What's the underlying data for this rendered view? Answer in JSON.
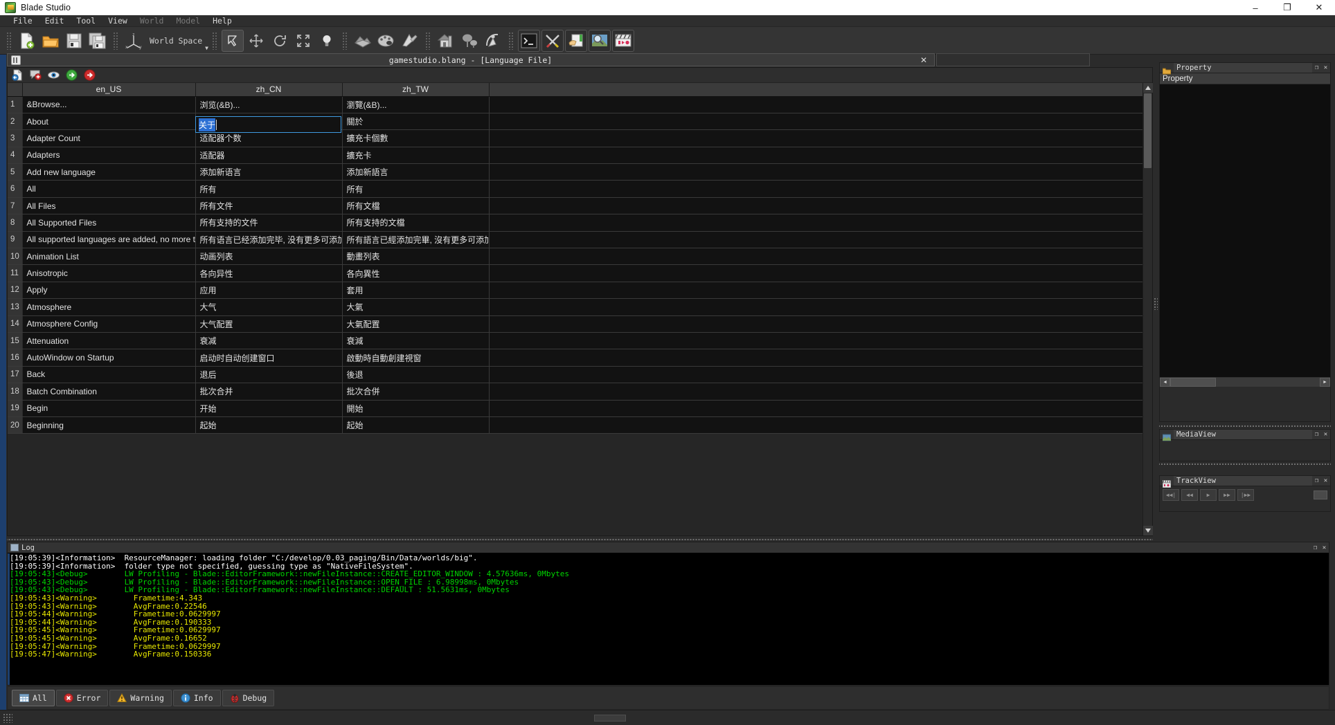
{
  "window": {
    "title": "Blade Studio",
    "app_icon": "app-icon",
    "minimize": "–",
    "maximize": "❐",
    "close": "✕"
  },
  "menu": {
    "items": [
      {
        "label": "File",
        "enabled": true
      },
      {
        "label": "Edit",
        "enabled": true
      },
      {
        "label": "Tool",
        "enabled": true
      },
      {
        "label": "View",
        "enabled": true
      },
      {
        "label": "World",
        "enabled": false
      },
      {
        "label": "Model",
        "enabled": false
      },
      {
        "label": "Help",
        "enabled": true
      }
    ]
  },
  "toolbar": {
    "space_label": "World Space",
    "groups": [
      {
        "icons": [
          "new-file-icon",
          "open-folder-icon",
          "save-icon",
          "save-all-icon"
        ]
      },
      {
        "icons": [
          "axis-gizmo-icon"
        ]
      },
      {
        "icons": [
          "select-arrow-icon",
          "move-icon",
          "rotate-icon",
          "scale-icon",
          "light-icon"
        ]
      },
      {
        "icons": [
          "terrain-icon",
          "palette-icon",
          "paint-icon"
        ]
      },
      {
        "icons": [
          "house-icon",
          "tree-icon",
          "physics-icon"
        ]
      },
      {
        "icons": [
          "console-icon",
          "tools-icon",
          "hand-paper-icon",
          "image-preview-icon",
          "clapperboard-icon"
        ]
      }
    ]
  },
  "document_tab": {
    "icon": "language-table-icon",
    "title": "gamestudio.blang - [Language File]",
    "close_label": "✕"
  },
  "editor_toolbar": {
    "icons": [
      "import-document-icon",
      "add-comment-icon",
      "eye-preview-icon",
      "next-green-icon",
      "jump-red-icon"
    ]
  },
  "table": {
    "columns": [
      "en_US",
      "zh_CN",
      "zh_TW"
    ],
    "editing": {
      "row": 2,
      "column": "zh_CN",
      "value": "关于",
      "selected": true
    },
    "rows": [
      {
        "n": "1",
        "en_US": "&Browse...",
        "zh_CN": "浏览(&B)...",
        "zh_TW": "瀏覽(&B)..."
      },
      {
        "n": "2",
        "en_US": "About",
        "zh_CN": "关于",
        "zh_TW": "關於"
      },
      {
        "n": "3",
        "en_US": "Adapter Count",
        "zh_CN": "适配器个数",
        "zh_TW": "擴充卡個數"
      },
      {
        "n": "4",
        "en_US": "Adapters",
        "zh_CN": "适配器",
        "zh_TW": "擴充卡"
      },
      {
        "n": "5",
        "en_US": "Add new language",
        "zh_CN": "添加新语言",
        "zh_TW": "添加新語言"
      },
      {
        "n": "6",
        "en_US": "All",
        "zh_CN": "所有",
        "zh_TW": "所有"
      },
      {
        "n": "7",
        "en_US": "All Files",
        "zh_CN": "所有文件",
        "zh_TW": "所有文檔"
      },
      {
        "n": "8",
        "en_US": "All Supported Files",
        "zh_CN": "所有支持的文件",
        "zh_TW": "所有支持的文檔"
      },
      {
        "n": "9",
        "en_US": "All supported languages are added, no more to add.",
        "zh_CN": "所有语言已经添加完毕, 没有更多可添加的语言.",
        "zh_TW": "所有語言已經添加完畢, 沒有更多可添加的語言."
      },
      {
        "n": "10",
        "en_US": "Animation List",
        "zh_CN": "动画列表",
        "zh_TW": "動畫列表"
      },
      {
        "n": "11",
        "en_US": "Anisotropic",
        "zh_CN": "各向异性",
        "zh_TW": "各向異性"
      },
      {
        "n": "12",
        "en_US": "Apply",
        "zh_CN": "应用",
        "zh_TW": "套用"
      },
      {
        "n": "13",
        "en_US": "Atmosphere",
        "zh_CN": "大气",
        "zh_TW": "大氣"
      },
      {
        "n": "14",
        "en_US": "Atmosphere Config",
        "zh_CN": "大气配置",
        "zh_TW": "大氣配置"
      },
      {
        "n": "15",
        "en_US": "Attenuation",
        "zh_CN": "衰减",
        "zh_TW": "衰減"
      },
      {
        "n": "16",
        "en_US": "AutoWindow on Startup",
        "zh_CN": "启动时自动创建窗口",
        "zh_TW": "啟動時自動創建視窗"
      },
      {
        "n": "17",
        "en_US": "Back",
        "zh_CN": "退后",
        "zh_TW": "後退"
      },
      {
        "n": "18",
        "en_US": "Batch Combination",
        "zh_CN": "批次合并",
        "zh_TW": "批次合併"
      },
      {
        "n": "19",
        "en_US": "Begin",
        "zh_CN": "开始",
        "zh_TW": "開始"
      },
      {
        "n": "20",
        "en_US": "Beginning",
        "zh_CN": "起始",
        "zh_TW": "起始"
      }
    ]
  },
  "docks": {
    "property": {
      "icon": "property-icon",
      "title": "Property",
      "subtitle": "Property",
      "float": "❐",
      "close": "✕"
    },
    "mediaview": {
      "icon": "mediaview-icon",
      "title": "MediaView",
      "float": "❐",
      "close": "✕"
    },
    "trackview": {
      "icon": "trackview-icon",
      "title": "TrackView",
      "float": "❐",
      "close": "✕",
      "buttons": [
        "skip-start-icon",
        "rewind-icon",
        "play-icon",
        "fast-forward-icon",
        "skip-end-icon"
      ]
    }
  },
  "log": {
    "icon": "log-icon",
    "title": "Log",
    "float": "❐",
    "close": "✕",
    "lines": [
      {
        "time": "[19:05:39]",
        "level": "Information",
        "text": "ResourceManager: loading folder \"C:/develop/0.03_paging/Bin/Data/worlds/big\"."
      },
      {
        "time": "[19:05:39]",
        "level": "Information",
        "text": "folder type not specified, guessing type as \"NativeFileSystem\"."
      },
      {
        "time": "[19:05:43]",
        "level": "Debug",
        "text": "      LW Profiling - Blade::EditorFramework::newFileInstance::CREATE_EDITOR_WINDOW : 4.57636ms, 0Mbytes"
      },
      {
        "time": "[19:05:43]",
        "level": "Debug",
        "text": "      LW Profiling - Blade::EditorFramework::newFileInstance::OPEN_FILE : 6.98998ms, 0Mbytes"
      },
      {
        "time": "[19:05:43]",
        "level": "Debug",
        "text": "      LW Profiling - Blade::EditorFramework::newFileInstance::DEFAULT : 51.5631ms, 0Mbytes"
      },
      {
        "time": "[19:05:43]",
        "level": "Warning",
        "text": "      Frametime:4.343"
      },
      {
        "time": "[19:05:43]",
        "level": "Warning",
        "text": "      AvgFrame:0.22546"
      },
      {
        "time": "[19:05:44]",
        "level": "Warning",
        "text": "      Frametime:0.0629997"
      },
      {
        "time": "[19:05:44]",
        "level": "Warning",
        "text": "      AvgFrame:0.190333"
      },
      {
        "time": "[19:05:45]",
        "level": "Warning",
        "text": "      Frametime:0.0629997"
      },
      {
        "time": "[19:05:45]",
        "level": "Warning",
        "text": "      AvgFrame:0.16652"
      },
      {
        "time": "[19:05:47]",
        "level": "Warning",
        "text": "      Frametime:0.0629997"
      },
      {
        "time": "[19:05:47]",
        "level": "Warning",
        "text": "      AvgFrame:0.150336"
      }
    ]
  },
  "log_filters": [
    {
      "label": "All",
      "icon": "grid-blue-icon",
      "active": true
    },
    {
      "label": "Error",
      "icon": "error-red-icon",
      "active": false
    },
    {
      "label": "Warning",
      "icon": "warning-triangle-icon",
      "active": false
    },
    {
      "label": "Info",
      "icon": "info-blue-icon",
      "active": false
    },
    {
      "label": "Debug",
      "icon": "ladybug-icon",
      "active": false
    }
  ],
  "colors": {
    "accent_blue": "#1d3f6e",
    "select_blue": "#2b6fd4",
    "edit_border": "#3f9ae0",
    "debug_green": "#00d400",
    "warning_yellow": "#e8e800",
    "error_red": "#ff3b30",
    "panel_bg": "#2b2b2b",
    "grid_bg": "#121212"
  }
}
